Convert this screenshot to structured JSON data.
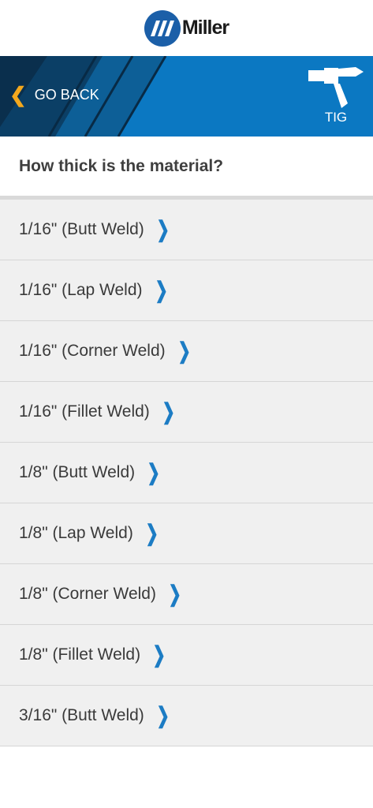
{
  "brand": {
    "name": "Miller",
    "primary_color": "#0b78c2",
    "accent_color": "#f4a81d"
  },
  "header": {
    "back_label": "GO BACK",
    "process_label": "TIG",
    "process_icon": "tig-torch-icon"
  },
  "question": "How thick is the material?",
  "options": [
    {
      "label": "1/16\" (Butt Weld)"
    },
    {
      "label": "1/16\" (Lap Weld)"
    },
    {
      "label": "1/16\" (Corner Weld)"
    },
    {
      "label": "1/16\" (Fillet Weld)"
    },
    {
      "label": "1/8\" (Butt Weld)"
    },
    {
      "label": "1/8\" (Lap Weld)"
    },
    {
      "label": "1/8\" (Corner Weld)"
    },
    {
      "label": "1/8\" (Fillet Weld)"
    },
    {
      "label": "3/16\" (Butt Weld)"
    }
  ]
}
